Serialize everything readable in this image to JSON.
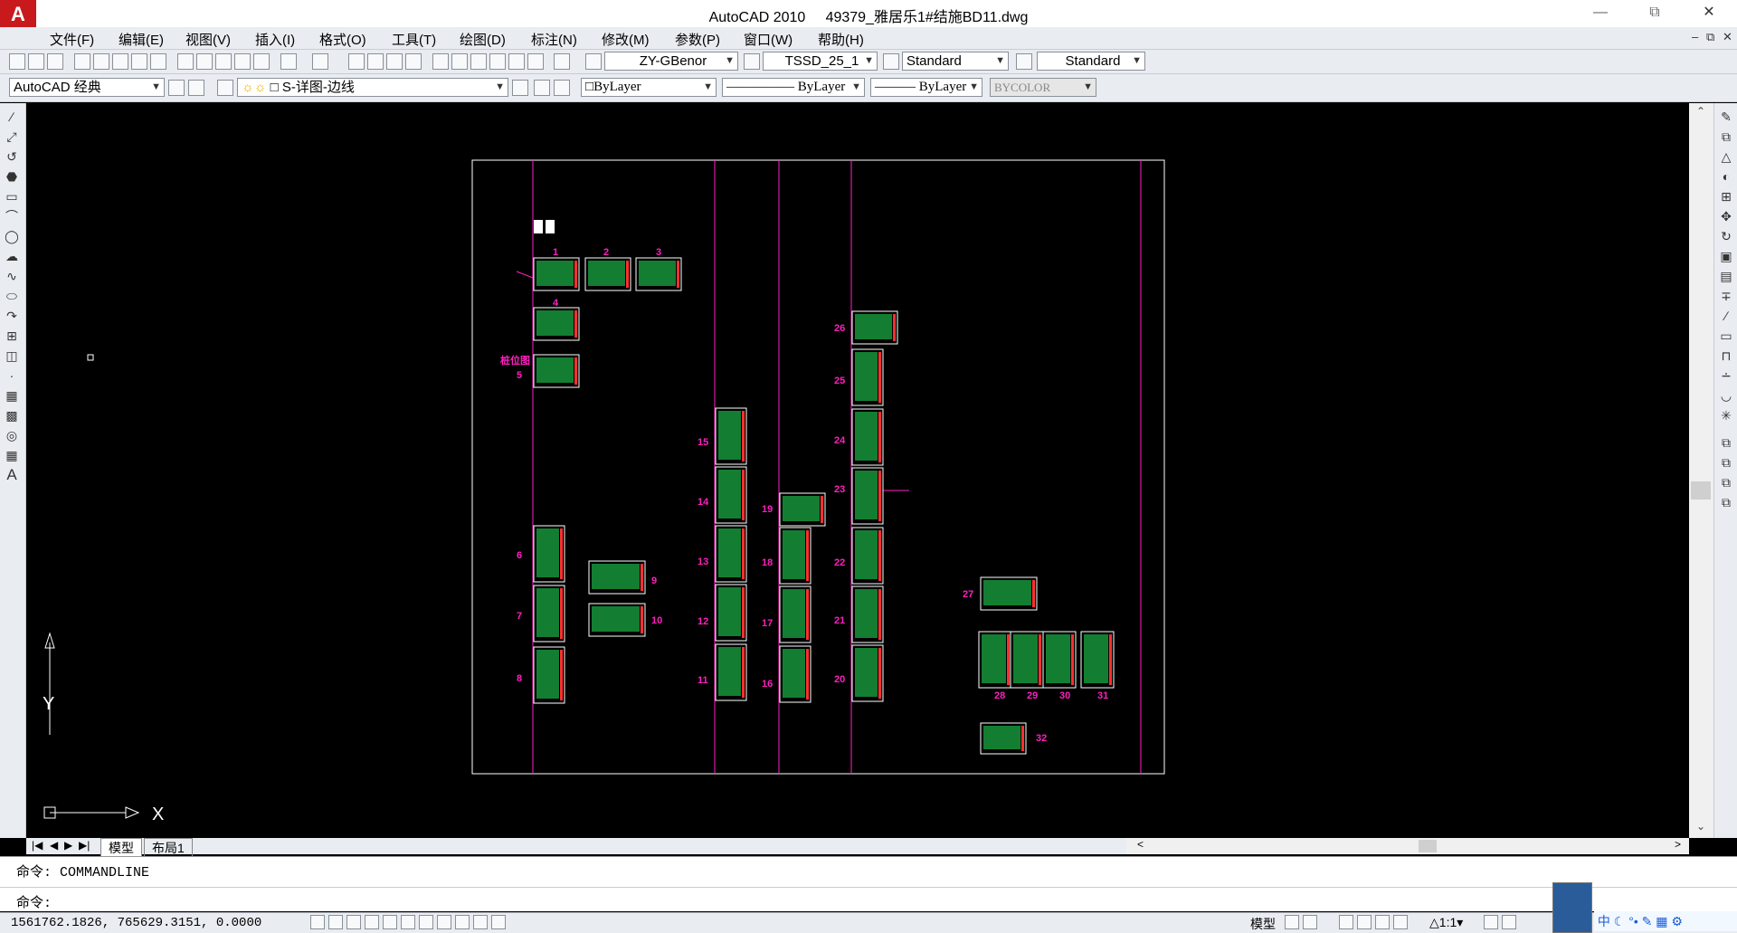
{
  "window": {
    "app_name": "AutoCAD 2010",
    "file_name": "49379_雅居乐1#结施BD11.dwg",
    "logo_letter": "A"
  },
  "menu": [
    "文件(F)",
    "编辑(E)",
    "视图(V)",
    "插入(I)",
    "格式(O)",
    "工具(T)",
    "绘图(D)",
    "标注(N)",
    "修改(M)",
    "参数(P)",
    "窗口(W)",
    "帮助(H)"
  ],
  "toolbar": {
    "text_style": "ZY-GBenor",
    "dim_style": "TSSD_25_1",
    "table_style": "Standard",
    "multileader_style": "Standard",
    "workspace": "AutoCAD 经典",
    "layer": "S-详图-边线",
    "color": "ByLayer",
    "linetype": "ByLayer",
    "lineweight": "ByLayer",
    "plotstyle": "BYCOLOR"
  },
  "layout_tabs": [
    "模型",
    "布局1"
  ],
  "ucs": {
    "y_label": "Y",
    "x_label": "X"
  },
  "drawing": {
    "line_color": "#ff1fbf",
    "sheet_fill": "#22e55a",
    "sheet_labels": [
      "1",
      "2",
      "3",
      "4",
      "5",
      "6",
      "7",
      "8",
      "9",
      "10",
      "11",
      "12",
      "13",
      "14",
      "15",
      "16",
      "17",
      "18",
      "19",
      "20",
      "21",
      "22",
      "23",
      "24",
      "25",
      "26",
      "27",
      "28",
      "29",
      "30",
      "31",
      "32"
    ],
    "side_note": "桩位图"
  },
  "command": {
    "history": "命令: COMMANDLINE",
    "prompt": "命令:"
  },
  "status": {
    "coordinates": "1561762.1826,  765629.3151,  0.0000",
    "space": "模型",
    "scale": "1:1"
  }
}
